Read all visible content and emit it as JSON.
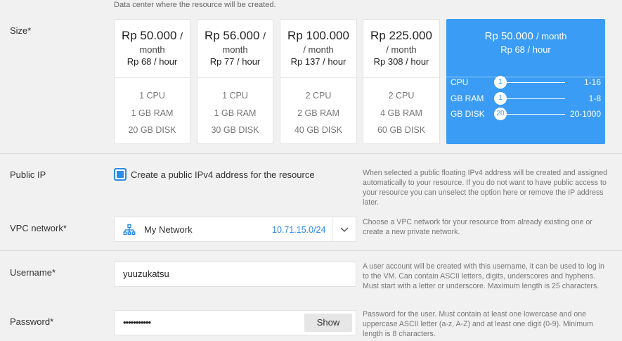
{
  "size": {
    "hint": "Data center where the resource will be created.",
    "label": "Size*",
    "cards": [
      {
        "price": "Rp 50.000",
        "slash": "/",
        "per": "month",
        "hourly": "Rp 68 / hour",
        "cpu": "1 CPU",
        "ram": "1 GB RAM",
        "disk": "20 GB DISK"
      },
      {
        "price": "Rp 56.000",
        "slash": "/",
        "per": "month",
        "hourly": "Rp 77 / hour",
        "cpu": "1 CPU",
        "ram": "1 GB RAM",
        "disk": "30 GB DISK"
      },
      {
        "price": "Rp 100.000",
        "slash": "",
        "per": "/ month",
        "hourly": "Rp 137 / hour",
        "cpu": "2 CPU",
        "ram": "2 GB RAM",
        "disk": "40 GB DISK"
      },
      {
        "price": "Rp 225.000",
        "slash": "",
        "per": "/ month",
        "hourly": "Rp 308 / hour",
        "cpu": "2 CPU",
        "ram": "4 GB RAM",
        "disk": "60 GB DISK"
      }
    ],
    "custom": {
      "price": "Rp 50.000",
      "per": "/ month",
      "hourly": "Rp 68 / hour",
      "sliders": [
        {
          "label": "CPU",
          "value": "1",
          "range": "1-16"
        },
        {
          "label": "GB RAM",
          "value": "1",
          "range": "1-8"
        },
        {
          "label": "GB DISK",
          "value": "20",
          "range": "20-1000"
        }
      ]
    }
  },
  "public_ip": {
    "label": "Public IP",
    "checkbox_label": "Create a public IPv4 address for the resource",
    "checked": true,
    "help": "When selected a public floating IPv4 address will be created and assigned automatically to your resource. If you do not want to have public access to your resource you can unselect the option here or remove the IP address later."
  },
  "vpc": {
    "label": "VPC network*",
    "name": "My Network",
    "address": "10.71.15.0/24",
    "help": "Choose a VPC network for your resource from already existing one or create a new private network."
  },
  "username": {
    "label": "Username*",
    "value": "yuuzukatsu",
    "help": "A user account will be created with this username, it can be used to log in to the VM. Can contain ASCII letters, digits, underscores and hyphens. Must start with a letter or underscore. Maximum length is 25 characters."
  },
  "password": {
    "label": "Password*",
    "value": "•••••••••••",
    "show_label": "Show",
    "help": "Password for the user. Must contain at least one lowercase and one uppercase ASCII letter (a-z, A-Z) and at least one digit (0-9). Minimum length is 8 characters."
  },
  "colors": {
    "accent": "#3a9cf5",
    "link": "#2a8be8"
  }
}
